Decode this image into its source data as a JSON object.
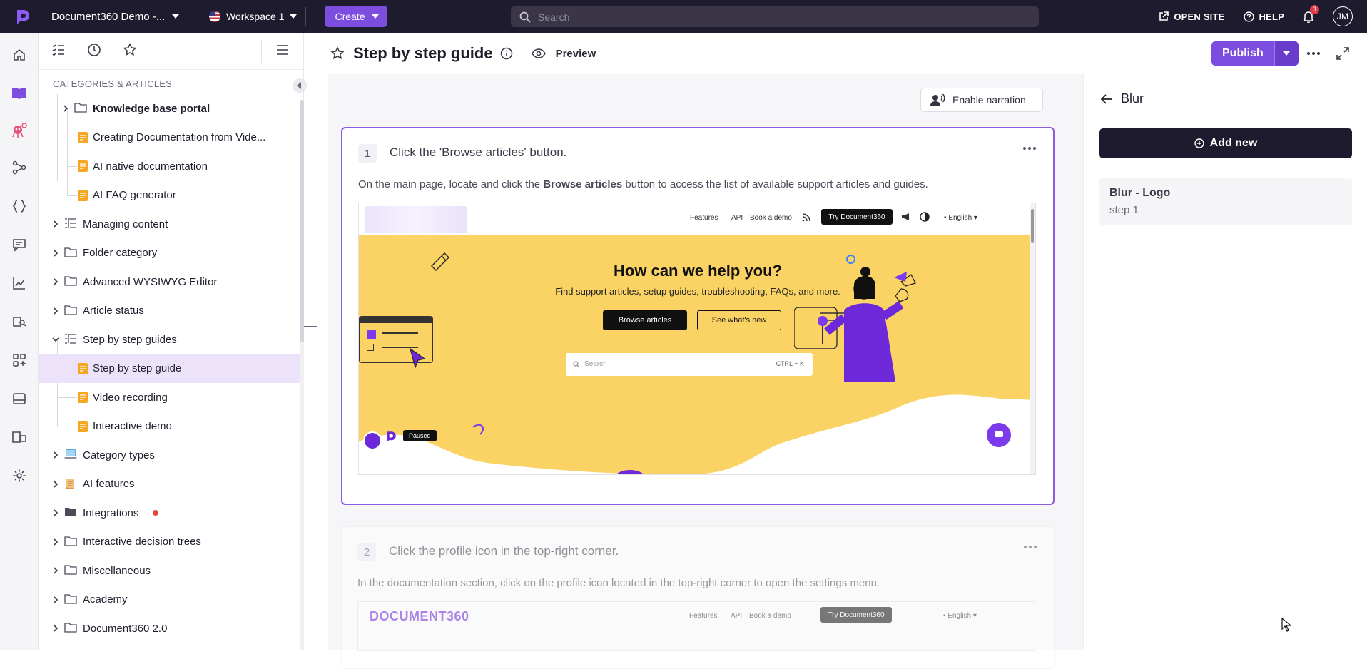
{
  "topbar": {
    "project": "Document360 Demo -...",
    "workspace": "Workspace 1",
    "create": "Create",
    "search_placeholder": "Search",
    "open_site": "OPEN SITE",
    "help": "HELP",
    "notifications": "3",
    "avatar": "JM"
  },
  "sidebar": {
    "heading": "CATEGORIES & ARTICLES",
    "items": [
      {
        "label": "Knowledge base portal",
        "type": "folder",
        "level": 1,
        "bold": true
      },
      {
        "label": "Creating Documentation from Vide...",
        "type": "article",
        "level": 2
      },
      {
        "label": "AI native documentation",
        "type": "article",
        "level": 2
      },
      {
        "label": "AI FAQ generator",
        "type": "article",
        "level": 2
      },
      {
        "label": "Managing content",
        "type": "list",
        "level": 0
      },
      {
        "label": "Folder category",
        "type": "folder",
        "level": 0
      },
      {
        "label": "Advanced WYSIWYG Editor",
        "type": "folder",
        "level": 0
      },
      {
        "label": "Article status",
        "type": "folder",
        "level": 0
      },
      {
        "label": "Step by step guides",
        "type": "list",
        "level": 0,
        "expanded": true
      },
      {
        "label": "Step by step guide",
        "type": "article",
        "level": 1,
        "selected": true
      },
      {
        "label": "Video recording",
        "type": "article",
        "level": 1
      },
      {
        "label": "Interactive demo",
        "type": "article",
        "level": 1
      },
      {
        "label": "Category types",
        "type": "emoji-laptop",
        "level": 0
      },
      {
        "label": "AI features",
        "type": "emoji-scroll",
        "level": 0
      },
      {
        "label": "Integrations",
        "type": "folder-filled",
        "level": 0,
        "dot": true
      },
      {
        "label": "Interactive decision trees",
        "type": "folder",
        "level": 0
      },
      {
        "label": "Miscellaneous",
        "type": "folder",
        "level": 0
      },
      {
        "label": "Academy",
        "type": "folder",
        "level": 0
      },
      {
        "label": "Document360 2.0",
        "type": "folder",
        "level": 0
      }
    ]
  },
  "header": {
    "title": "Step by step guide",
    "preview": "Preview",
    "publish": "Publish"
  },
  "editor": {
    "narration": "Enable narration",
    "steps": [
      {
        "number": "1",
        "title": "Click the 'Browse articles' button.",
        "desc_pre": "On the main page, locate and click the ",
        "desc_bold": "Browse articles",
        "desc_post": " button to access the list of available support articles and guides.",
        "screenshot": {
          "nav": [
            "Features",
            "API",
            "Book a demo"
          ],
          "try_btn": "Try Document360",
          "lang": "English",
          "hero_title": "How can we help you?",
          "hero_sub": "Find support articles, setup guides, troubleshooting, FAQs, and more.",
          "browse": "Browse articles",
          "whats_new": "See what's new",
          "search": "Search",
          "shortcut": "CTRL + K",
          "paused": "Paused"
        }
      },
      {
        "number": "2",
        "title": "Click the profile icon in the top-right corner.",
        "desc": "In the documentation section, click on the profile icon located in the top-right corner to open the settings menu.",
        "screenshot": {
          "logo": "DOCUMENT360",
          "nav": [
            "Features",
            "API",
            "Book a demo"
          ],
          "try_btn": "Try Document360",
          "lang": "English"
        }
      }
    ]
  },
  "panel": {
    "back_label": "Blur",
    "add_new": "Add new",
    "blur_name": "Blur - Logo",
    "blur_step": "step 1"
  },
  "colors": {
    "accent": "#7c4dde",
    "dark": "#1f1b2e",
    "hero": "#fbd364"
  }
}
